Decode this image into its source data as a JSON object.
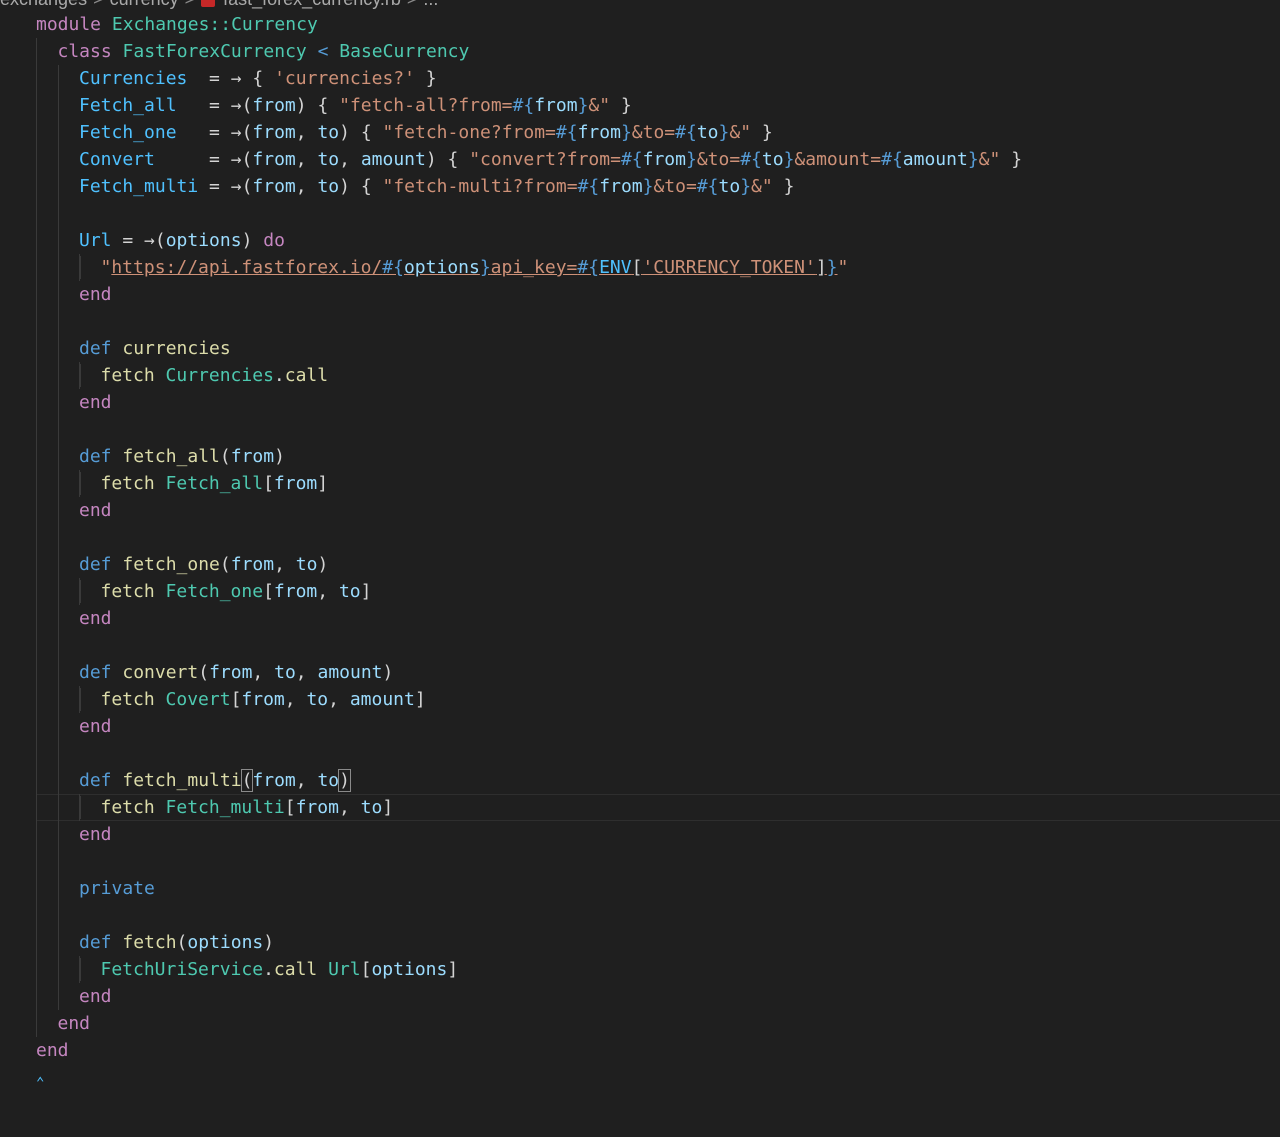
{
  "breadcrumb": {
    "items": [
      "exchanges",
      "currency",
      "fast_forex_currency.rb",
      "..."
    ],
    "separator": ">"
  },
  "colors": {
    "background": "#1f1f1f",
    "keyword": "#c586c0",
    "def_keyword": "#569cd6",
    "type": "#4ec9b0",
    "constant": "#4fc1ff",
    "variable": "#9cdcfe",
    "function": "#dcdcaa",
    "string": "#ce9178",
    "plain": "#d4d4d4"
  },
  "cursor_line": 29,
  "code": [
    {
      "indent": 1,
      "tokens": [
        [
          "kw",
          "module"
        ],
        [
          "pl",
          " "
        ],
        [
          "ty",
          "Exchanges::Currency"
        ]
      ]
    },
    {
      "indent": 2,
      "tokens": [
        [
          "kw",
          "class"
        ],
        [
          "pl",
          " "
        ],
        [
          "ty",
          "FastForexCurrency"
        ],
        [
          "pl",
          " "
        ],
        [
          "dkw",
          "<"
        ],
        [
          "pl",
          " "
        ],
        [
          "ty",
          "BaseCurrency"
        ]
      ]
    },
    {
      "indent": 3,
      "tokens": [
        [
          "cn",
          "Currencies"
        ],
        [
          "pl",
          "  = → { "
        ],
        [
          "st",
          "'currencies?'"
        ],
        [
          "pl",
          " }"
        ]
      ]
    },
    {
      "indent": 3,
      "tokens": [
        [
          "cn",
          "Fetch_all"
        ],
        [
          "pl",
          "   = →("
        ],
        [
          "va",
          "from"
        ],
        [
          "pl",
          ") { "
        ],
        [
          "st",
          "\"fetch-all?from="
        ],
        [
          "ip",
          "#{"
        ],
        [
          "va",
          "from"
        ],
        [
          "ip",
          "}"
        ],
        [
          "st",
          "&\""
        ],
        [
          "pl",
          " }"
        ]
      ]
    },
    {
      "indent": 3,
      "tokens": [
        [
          "cn",
          "Fetch_one"
        ],
        [
          "pl",
          "   = →("
        ],
        [
          "va",
          "from"
        ],
        [
          "pl",
          ", "
        ],
        [
          "va",
          "to"
        ],
        [
          "pl",
          ") { "
        ],
        [
          "st",
          "\"fetch-one?from="
        ],
        [
          "ip",
          "#{"
        ],
        [
          "va",
          "from"
        ],
        [
          "ip",
          "}"
        ],
        [
          "st",
          "&to="
        ],
        [
          "ip",
          "#{"
        ],
        [
          "va",
          "to"
        ],
        [
          "ip",
          "}"
        ],
        [
          "st",
          "&\""
        ],
        [
          "pl",
          " }"
        ]
      ]
    },
    {
      "indent": 3,
      "tokens": [
        [
          "cn",
          "Convert"
        ],
        [
          "pl",
          "     = →("
        ],
        [
          "va",
          "from"
        ],
        [
          "pl",
          ", "
        ],
        [
          "va",
          "to"
        ],
        [
          "pl",
          ", "
        ],
        [
          "va",
          "amount"
        ],
        [
          "pl",
          ") { "
        ],
        [
          "st",
          "\"convert?from="
        ],
        [
          "ip",
          "#{"
        ],
        [
          "va",
          "from"
        ],
        [
          "ip",
          "}"
        ],
        [
          "st",
          "&to="
        ],
        [
          "ip",
          "#{"
        ],
        [
          "va",
          "to"
        ],
        [
          "ip",
          "}"
        ],
        [
          "st",
          "&amount="
        ],
        [
          "ip",
          "#{"
        ],
        [
          "va",
          "amount"
        ],
        [
          "ip",
          "}"
        ],
        [
          "st",
          "&\""
        ],
        [
          "pl",
          " }"
        ]
      ]
    },
    {
      "indent": 3,
      "tokens": [
        [
          "cn",
          "Fetch_multi"
        ],
        [
          "pl",
          " = →("
        ],
        [
          "va",
          "from"
        ],
        [
          "pl",
          ", "
        ],
        [
          "va",
          "to"
        ],
        [
          "pl",
          ") { "
        ],
        [
          "st",
          "\"fetch-multi?from="
        ],
        [
          "ip",
          "#{"
        ],
        [
          "va",
          "from"
        ],
        [
          "ip",
          "}"
        ],
        [
          "st",
          "&to="
        ],
        [
          "ip",
          "#{"
        ],
        [
          "va",
          "to"
        ],
        [
          "ip",
          "}"
        ],
        [
          "st",
          "&\""
        ],
        [
          "pl",
          " }"
        ]
      ]
    },
    {
      "indent": 0,
      "tokens": []
    },
    {
      "indent": 3,
      "tokens": [
        [
          "cn",
          "Url"
        ],
        [
          "pl",
          " = →("
        ],
        [
          "va",
          "options"
        ],
        [
          "pl",
          ") "
        ],
        [
          "kw",
          "do"
        ]
      ]
    },
    {
      "indent": 4,
      "tokens": [
        [
          "st",
          "\""
        ],
        [
          "st ul",
          "https://api.fastforex.io/"
        ],
        [
          "ip ul",
          "#{"
        ],
        [
          "va ul",
          "options"
        ],
        [
          "ip ul",
          "}"
        ],
        [
          "st ul",
          "api_key="
        ],
        [
          "ip ul",
          "#{"
        ],
        [
          "cn ul",
          "ENV"
        ],
        [
          "pl ul",
          "["
        ],
        [
          "st ul",
          "'CURRENCY_TOKEN'"
        ],
        [
          "pl ul",
          "]"
        ],
        [
          "ip ul",
          "}"
        ],
        [
          "st",
          "\""
        ]
      ]
    },
    {
      "indent": 3,
      "tokens": [
        [
          "kw",
          "end"
        ]
      ]
    },
    {
      "indent": 0,
      "tokens": []
    },
    {
      "indent": 3,
      "tokens": [
        [
          "dkw",
          "def"
        ],
        [
          "pl",
          " "
        ],
        [
          "fn",
          "currencies"
        ]
      ]
    },
    {
      "indent": 4,
      "tokens": [
        [
          "fn",
          "fetch"
        ],
        [
          "pl",
          " "
        ],
        [
          "ty",
          "Currencies"
        ],
        [
          "pl",
          "."
        ],
        [
          "fn",
          "call"
        ]
      ]
    },
    {
      "indent": 3,
      "tokens": [
        [
          "kw",
          "end"
        ]
      ]
    },
    {
      "indent": 0,
      "tokens": []
    },
    {
      "indent": 3,
      "tokens": [
        [
          "dkw",
          "def"
        ],
        [
          "pl",
          " "
        ],
        [
          "fn",
          "fetch_all"
        ],
        [
          "pl",
          "("
        ],
        [
          "va",
          "from"
        ],
        [
          "pl",
          ")"
        ]
      ]
    },
    {
      "indent": 4,
      "tokens": [
        [
          "fn",
          "fetch"
        ],
        [
          "pl",
          " "
        ],
        [
          "ty",
          "Fetch_all"
        ],
        [
          "pl",
          "["
        ],
        [
          "va",
          "from"
        ],
        [
          "pl",
          "]"
        ]
      ]
    },
    {
      "indent": 3,
      "tokens": [
        [
          "kw",
          "end"
        ]
      ]
    },
    {
      "indent": 0,
      "tokens": []
    },
    {
      "indent": 3,
      "tokens": [
        [
          "dkw",
          "def"
        ],
        [
          "pl",
          " "
        ],
        [
          "fn",
          "fetch_one"
        ],
        [
          "pl",
          "("
        ],
        [
          "va",
          "from"
        ],
        [
          "pl",
          ", "
        ],
        [
          "va",
          "to"
        ],
        [
          "pl",
          ")"
        ]
      ]
    },
    {
      "indent": 4,
      "tokens": [
        [
          "fn",
          "fetch"
        ],
        [
          "pl",
          " "
        ],
        [
          "ty",
          "Fetch_one"
        ],
        [
          "pl",
          "["
        ],
        [
          "va",
          "from"
        ],
        [
          "pl",
          ", "
        ],
        [
          "va",
          "to"
        ],
        [
          "pl",
          "]"
        ]
      ]
    },
    {
      "indent": 3,
      "tokens": [
        [
          "kw",
          "end"
        ]
      ]
    },
    {
      "indent": 0,
      "tokens": []
    },
    {
      "indent": 3,
      "tokens": [
        [
          "dkw",
          "def"
        ],
        [
          "pl",
          " "
        ],
        [
          "fn",
          "convert"
        ],
        [
          "pl",
          "("
        ],
        [
          "va",
          "from"
        ],
        [
          "pl",
          ", "
        ],
        [
          "va",
          "to"
        ],
        [
          "pl",
          ", "
        ],
        [
          "va",
          "amount"
        ],
        [
          "pl",
          ")"
        ]
      ]
    },
    {
      "indent": 4,
      "tokens": [
        [
          "fn",
          "fetch"
        ],
        [
          "pl",
          " "
        ],
        [
          "ty",
          "Covert"
        ],
        [
          "pl",
          "["
        ],
        [
          "va",
          "from"
        ],
        [
          "pl",
          ", "
        ],
        [
          "va",
          "to"
        ],
        [
          "pl",
          ", "
        ],
        [
          "va",
          "amount"
        ],
        [
          "pl",
          "]"
        ]
      ]
    },
    {
      "indent": 3,
      "tokens": [
        [
          "kw",
          "end"
        ]
      ]
    },
    {
      "indent": 0,
      "tokens": []
    },
    {
      "indent": 3,
      "tokens": [
        [
          "dkw",
          "def"
        ],
        [
          "pl",
          " "
        ],
        [
          "fn",
          "fetch_multi"
        ],
        [
          "pl bracket-match",
          "("
        ],
        [
          "va",
          "from"
        ],
        [
          "pl",
          ", "
        ],
        [
          "va",
          "to"
        ],
        [
          "pl bracket-match",
          ")"
        ]
      ]
    },
    {
      "indent": 4,
      "tokens": [
        [
          "fn",
          "fetch"
        ],
        [
          "pl",
          " "
        ],
        [
          "ty",
          "Fetch_multi"
        ],
        [
          "pl",
          "["
        ],
        [
          "va",
          "from"
        ],
        [
          "pl",
          ", "
        ],
        [
          "va",
          "to"
        ],
        [
          "pl",
          "]"
        ]
      ]
    },
    {
      "indent": 3,
      "tokens": [
        [
          "kw",
          "end"
        ]
      ]
    },
    {
      "indent": 0,
      "tokens": []
    },
    {
      "indent": 3,
      "tokens": [
        [
          "dkw",
          "private"
        ]
      ]
    },
    {
      "indent": 0,
      "tokens": []
    },
    {
      "indent": 3,
      "tokens": [
        [
          "dkw",
          "def"
        ],
        [
          "pl",
          " "
        ],
        [
          "fn",
          "fetch"
        ],
        [
          "pl",
          "("
        ],
        [
          "va",
          "options"
        ],
        [
          "pl",
          ")"
        ]
      ]
    },
    {
      "indent": 4,
      "tokens": [
        [
          "ty",
          "FetchUriService"
        ],
        [
          "pl",
          "."
        ],
        [
          "fn",
          "call"
        ],
        [
          "pl",
          " "
        ],
        [
          "ty",
          "Url"
        ],
        [
          "pl",
          "["
        ],
        [
          "va",
          "options"
        ],
        [
          "pl",
          "]"
        ]
      ]
    },
    {
      "indent": 3,
      "tokens": [
        [
          "kw",
          "end"
        ]
      ]
    },
    {
      "indent": 2,
      "tokens": [
        [
          "kw",
          "end"
        ]
      ]
    },
    {
      "indent": 1,
      "tokens": [
        [
          "kw",
          "end"
        ]
      ]
    }
  ]
}
